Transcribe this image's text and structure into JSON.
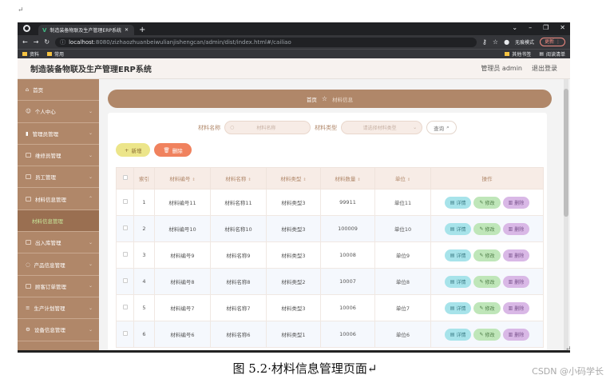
{
  "doc": {
    "para_mark": "↵",
    "caption": "图 5.2·材料信息管理页面↵",
    "watermark": "CSDN @小码学长"
  },
  "browser": {
    "tab_title": "制造装备物联及生产管理ERP系统",
    "new_tab": "+",
    "url_host": "localhost",
    "url_rest": ":8080/zizhaozhuanbeiwulianjishengcan/admin/dist/index.html#/cailiao",
    "incognito": "无痕模式",
    "update_label": "更新",
    "bookmarks": [
      "资料",
      "常用"
    ],
    "bookmarks_right": [
      "其他书签",
      "阅读清单"
    ]
  },
  "header": {
    "title": "制造装备物联及生产管理ERP系统",
    "user": "管理员 admin",
    "logout": "退出登录"
  },
  "sidebar": {
    "items": [
      {
        "label": "首页"
      },
      {
        "label": "个人中心"
      },
      {
        "label": "管理员管理"
      },
      {
        "label": "维修员管理"
      },
      {
        "label": "员工管理"
      },
      {
        "label": "材料信息管理"
      },
      {
        "label": "出入库管理"
      },
      {
        "label": "产品信息管理"
      },
      {
        "label": "顾客订单管理"
      },
      {
        "label": "生产计划管理"
      },
      {
        "label": "设备信息管理"
      }
    ],
    "sub": "材料信息管理"
  },
  "breadcrumb": {
    "home": "首页",
    "current": "材料信息"
  },
  "search": {
    "name_label": "材料名称",
    "name_placeholder": "材料名称",
    "type_label": "材料类型",
    "type_placeholder": "请选择材料类型",
    "query": "查询"
  },
  "buttons": {
    "add": "新增",
    "delete": "删除"
  },
  "table": {
    "headers": [
      "索引",
      "材料编号",
      "材料名称",
      "材料类型",
      "材料数量",
      "单位",
      "操作"
    ],
    "op_labels": [
      "详情",
      "修改",
      "删除"
    ],
    "rows": [
      [
        "1",
        "材料编号11",
        "材料名称11",
        "材料类型3",
        "99911",
        "单位11"
      ],
      [
        "2",
        "材料编号10",
        "材料名称10",
        "材料类型3",
        "100009",
        "单位10"
      ],
      [
        "3",
        "材料编号9",
        "材料名称9",
        "材料类型3",
        "10008",
        "单位9"
      ],
      [
        "4",
        "材料编号8",
        "材料名称8",
        "材料类型2",
        "10007",
        "单位8"
      ],
      [
        "5",
        "材料编号7",
        "材料名称7",
        "材料类型3",
        "10006",
        "单位7"
      ],
      [
        "6",
        "材料编号6",
        "材料名称6",
        "材料类型1",
        "10006",
        "单位6"
      ]
    ]
  },
  "colors": {
    "brand": "#b08769",
    "header_bg": "#f7f2ef",
    "detail": "#a7e3ea",
    "edit": "#bfe6b9",
    "remove": "#d9b8e6",
    "add": "#ece58a",
    "del": "#f0825e"
  }
}
